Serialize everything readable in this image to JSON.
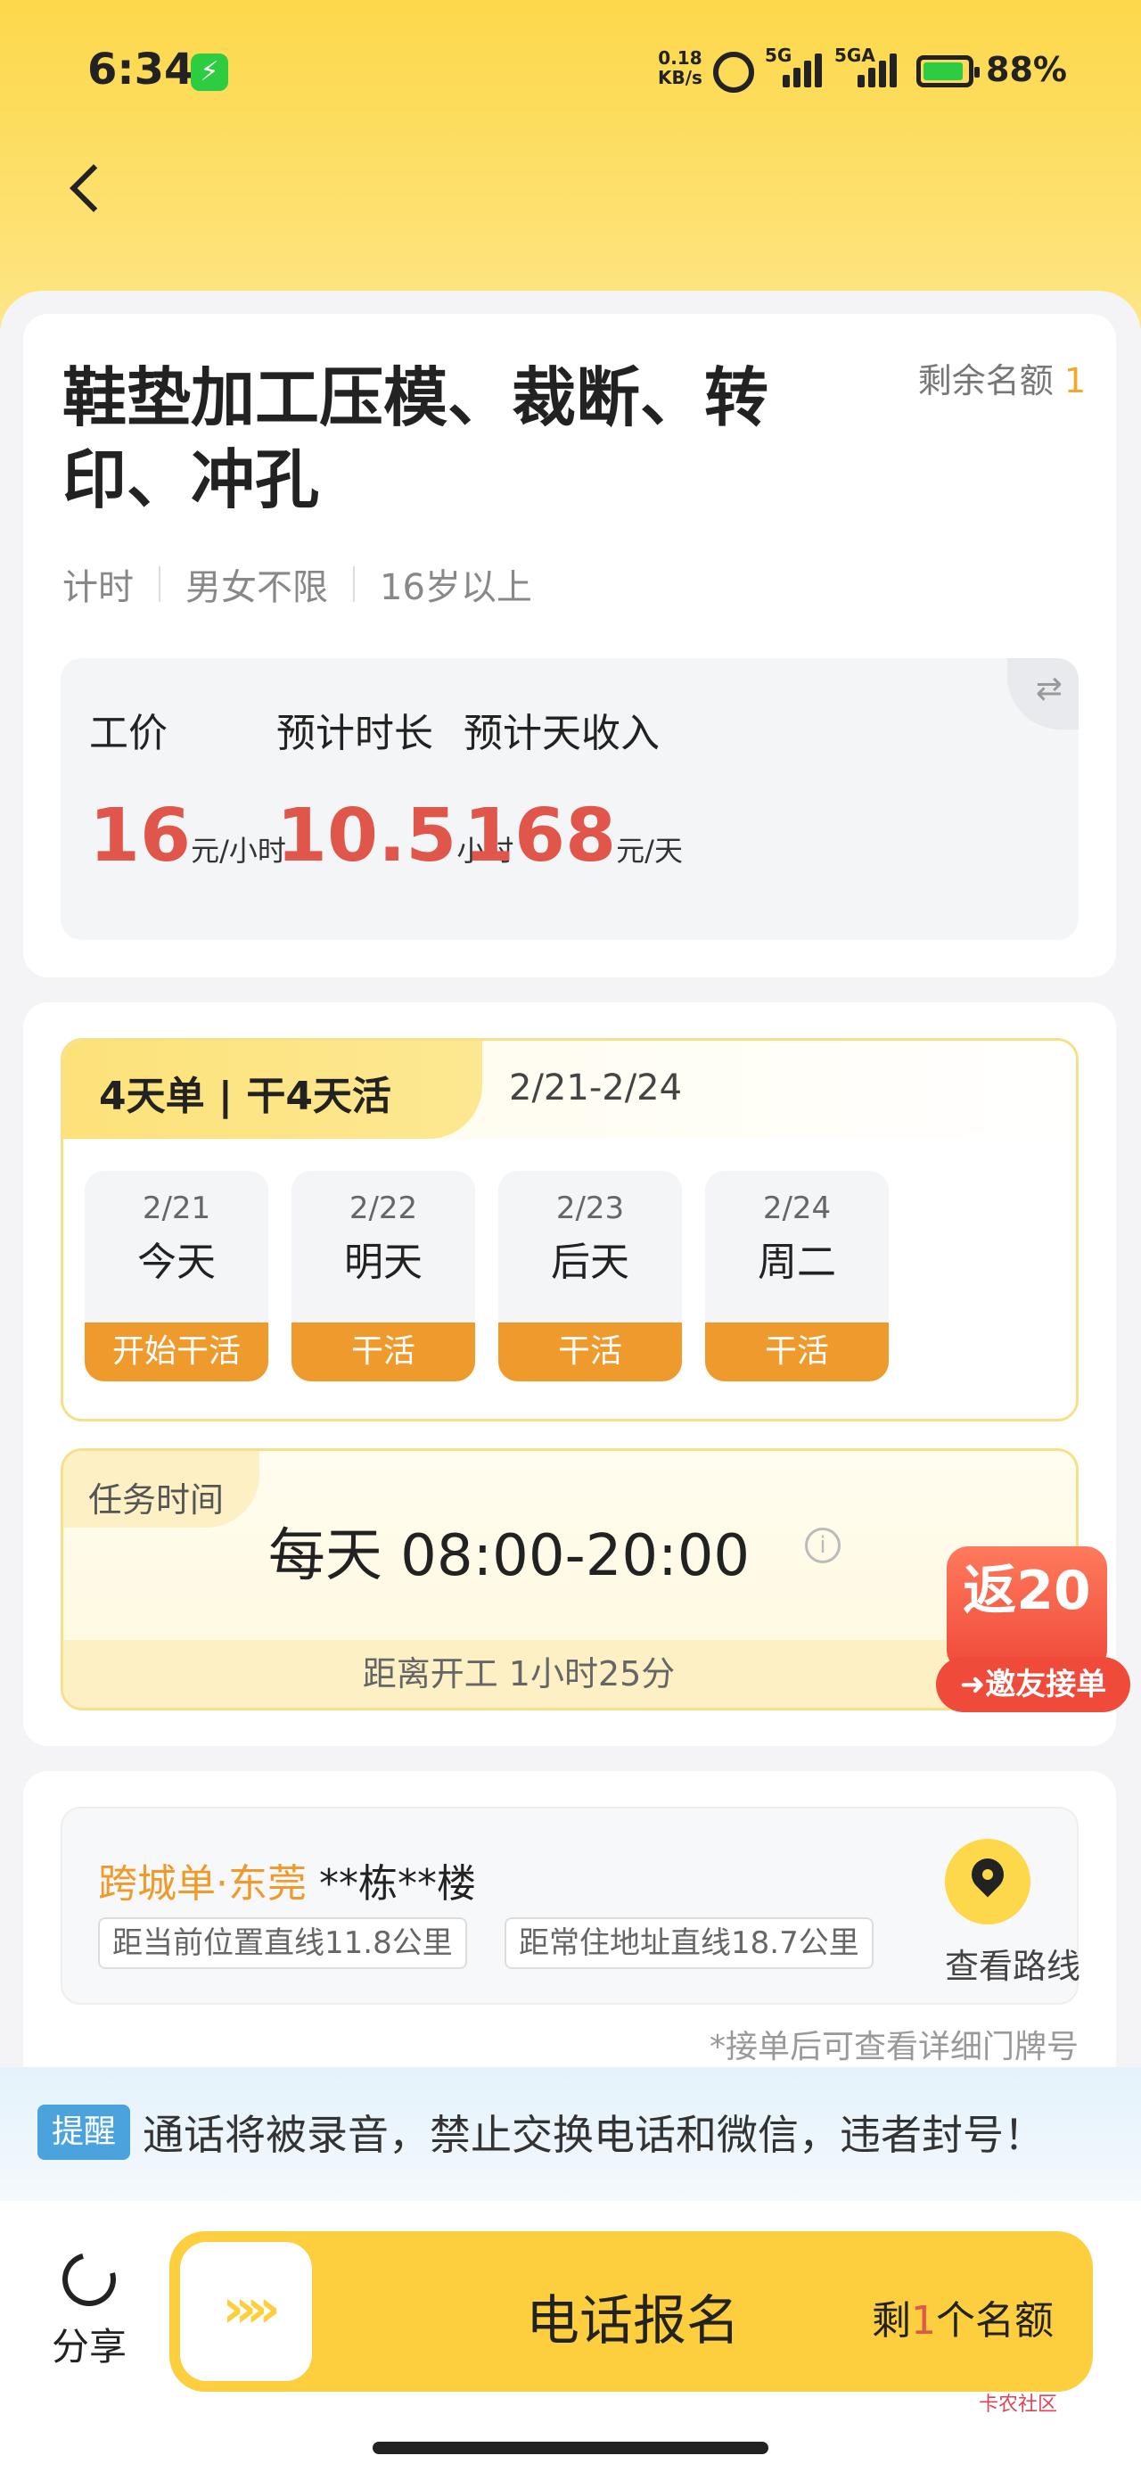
{
  "status": {
    "time": "6:34",
    "net_speed_value": "0.18",
    "net_speed_unit": "KB/s",
    "sig1": "5G",
    "sig2": "5GA",
    "battery": "88%"
  },
  "job": {
    "title": "鞋垫加工压模、裁断、转印、冲孔",
    "quota_label": "剩余名额",
    "quota_value": "1",
    "tags": [
      "计时",
      "男女不限",
      "16岁以上"
    ],
    "stats": [
      {
        "label": "工价",
        "value": "16",
        "unit": "元/小时"
      },
      {
        "label": "预计时长",
        "value": "10.5",
        "unit": "小时"
      },
      {
        "label": "预计天收入",
        "value": "168",
        "unit": "元/天"
      }
    ]
  },
  "schedule": {
    "tag": "4天单 | 干4天活",
    "range": "2/21-2/24",
    "days": [
      {
        "date": "2/21",
        "name": "今天",
        "action": "开始干活"
      },
      {
        "date": "2/22",
        "name": "明天",
        "action": "干活"
      },
      {
        "date": "2/23",
        "name": "后天",
        "action": "干活"
      },
      {
        "date": "2/24",
        "name": "周二",
        "action": "干活"
      }
    ]
  },
  "task_time": {
    "tag": "任务时间",
    "hours": "每天 08:00-20:00",
    "countdown": "距离开工 1小时25分"
  },
  "promo": {
    "amount": "返20",
    "label": "邀友接单"
  },
  "location": {
    "type": "跨城单·东莞",
    "address": "**栋**楼",
    "dist_current": "距当前位置直线11.8公里",
    "dist_home": "距常住地址直线18.7公里",
    "route_label": "查看路线",
    "door_note": "*接单后可查看详细门牌号"
  },
  "notice": {
    "tag": "提醒",
    "text": "通话将被录音，禁止交换电话和微信，违者封号！"
  },
  "bottom": {
    "share_label": "分享",
    "arrows": "»»",
    "cta_label": "电话报名",
    "remain_pre": "剩",
    "remain_num": "1",
    "remain_post": "个名额"
  },
  "watermark": "卡农社区"
}
